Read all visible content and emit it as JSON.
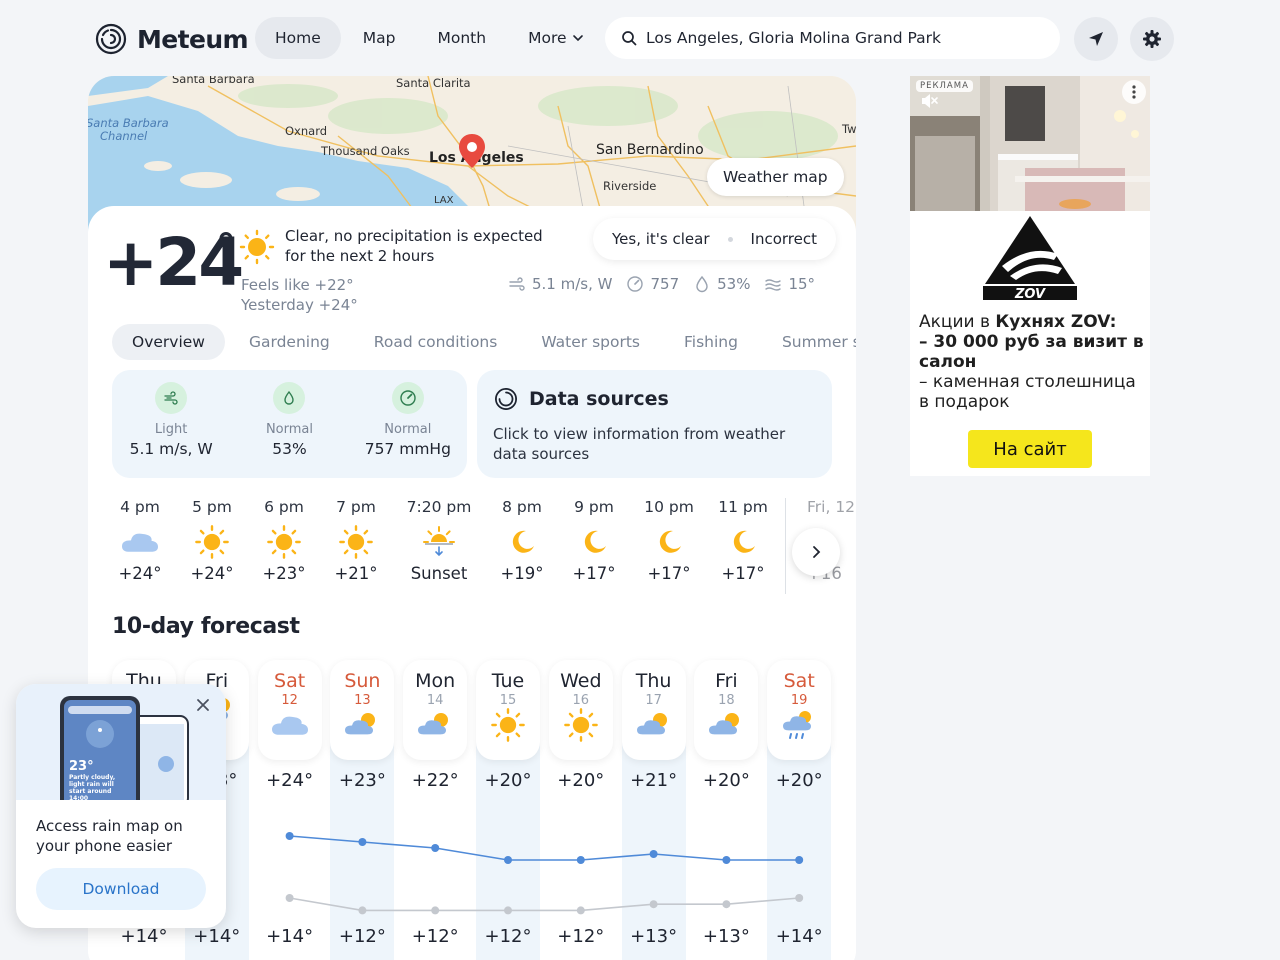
{
  "header": {
    "logo_text": "Meteum",
    "nav": [
      {
        "label": "Home"
      },
      {
        "label": "Map"
      },
      {
        "label": "Month"
      },
      {
        "label": "More"
      }
    ],
    "search_value": "Los Angeles, Gloria Molina Grand Park",
    "icons": [
      "search-icon",
      "location-arrow-icon",
      "gear-icon"
    ]
  },
  "map": {
    "labels": [
      "Santa Barbara",
      "Santa Clarita",
      "Santa Barbara",
      "Channel",
      "Oxnard",
      "Thousand Oaks",
      "Los Angeles",
      "San Bernardino",
      "Riverside",
      "LAX",
      "Tw"
    ],
    "weather_map_label": "Weather map"
  },
  "now": {
    "temp": "+24",
    "deg": "°",
    "desc": "Clear, no precipitation is expected for the next 2 hours",
    "feels_like": "Feels like +22°",
    "yesterday": "Yesterday +24°",
    "feedback_yes": "Yes, it's clear",
    "feedback_no": "Incorrect",
    "wind": "5.1 m/s, W",
    "pressure": "757",
    "humidity": "53%",
    "water_temp": "15°"
  },
  "tabs": [
    "Overview",
    "Gardening",
    "Road conditions",
    "Water sports",
    "Fishing",
    "Summer s"
  ],
  "conditions": [
    {
      "label": "Light",
      "value": "5.1 m/s, W",
      "icon": "wind-icon"
    },
    {
      "label": "Normal",
      "value": "53%",
      "icon": "humidity-icon"
    },
    {
      "label": "Normal",
      "value": "757 mmHg",
      "icon": "pressure-icon"
    }
  ],
  "sources": {
    "title": "Data sources",
    "text": "Click to view information from weather data sources"
  },
  "hourly": [
    {
      "time": "4 pm",
      "temp": "+24°",
      "icon": "cloudy-icon"
    },
    {
      "time": "5 pm",
      "temp": "+24°",
      "icon": "sun-icon"
    },
    {
      "time": "6 pm",
      "temp": "+23°",
      "icon": "sun-icon"
    },
    {
      "time": "7 pm",
      "temp": "+21°",
      "icon": "sun-icon"
    },
    {
      "time": "7:20 pm",
      "temp": "Sunset",
      "icon": "sunset-icon"
    },
    {
      "time": "8 pm",
      "temp": "+19°",
      "icon": "moon-icon"
    },
    {
      "time": "9 pm",
      "temp": "+17°",
      "icon": "moon-icon"
    },
    {
      "time": "10 pm",
      "temp": "+17°",
      "icon": "moon-icon"
    },
    {
      "time": "11 pm",
      "temp": "+17°",
      "icon": "moon-icon"
    },
    {
      "time": "Fri, 12",
      "temp": "+16",
      "icon": "moon-icon"
    }
  ],
  "forecast": {
    "title": "10-day forecast",
    "days": [
      {
        "dow": "Thu",
        "date": "",
        "high": "",
        "low": "+14°",
        "weekend": false,
        "icon": "partly-cloudy-icon"
      },
      {
        "dow": "Fri",
        "date": "",
        "high": "+ 3°",
        "low": "+14°",
        "weekend": false,
        "icon": "partly-cloudy-icon"
      },
      {
        "dow": "Sat",
        "date": "12",
        "high": "+24°",
        "low": "+14°",
        "weekend": true,
        "icon": "cloudy-icon"
      },
      {
        "dow": "Sun",
        "date": "13",
        "high": "+23°",
        "low": "+12°",
        "weekend": true,
        "icon": "partly-cloudy-icon"
      },
      {
        "dow": "Mon",
        "date": "14",
        "high": "+22°",
        "low": "+12°",
        "weekend": false,
        "icon": "partly-cloudy-icon"
      },
      {
        "dow": "Tue",
        "date": "15",
        "high": "+20°",
        "low": "+12°",
        "weekend": false,
        "icon": "sun-icon"
      },
      {
        "dow": "Wed",
        "date": "16",
        "high": "+20°",
        "low": "+12°",
        "weekend": false,
        "icon": "sun-icon"
      },
      {
        "dow": "Thu",
        "date": "17",
        "high": "+21°",
        "low": "+13°",
        "weekend": false,
        "icon": "partly-cloudy-icon"
      },
      {
        "dow": "Fri",
        "date": "18",
        "high": "+20°",
        "low": "+13°",
        "weekend": false,
        "icon": "partly-cloudy-icon"
      },
      {
        "dow": "Sat",
        "date": "19",
        "high": "+20°",
        "low": "+14°",
        "weekend": true,
        "icon": "rain-icon"
      }
    ]
  },
  "ad": {
    "badge": "РЕКЛАМА",
    "brand": "ZOV",
    "line1_pre": "Акции в ",
    "line1_bold": "Кухнях ZOV:",
    "line2": "– 30 000 руб за визит в салон",
    "line3": "– каменная столешница в подарок",
    "button": "На сайт"
  },
  "popup": {
    "text": "Access rain map on your phone easier",
    "button": "Download",
    "phone_temp": "23°",
    "phone_desc": "Partly cloudy, light rain will start around 14:00"
  },
  "colors": {
    "accent_blue": "#4f8ad8",
    "weekend": "#d65a3b",
    "sun": "#fbb417",
    "ad_button": "#f5e61c"
  }
}
